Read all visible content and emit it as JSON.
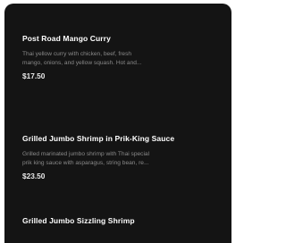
{
  "menu": {
    "items": [
      {
        "title": "Post Road Mango Curry",
        "description_line1": "Thai yellow curry with chicken, beef, fresh",
        "description_line2": "mango, onions, and yellow squash. Hot and...",
        "price": "$17.50"
      },
      {
        "title": "Grilled Jumbo Shrimp in Prik-King Sauce",
        "description_line1": "Grilled marinated jumbo shrimp with Thai special",
        "description_line2": "prik king sauce with asparagus, string bean, re...",
        "price": "$23.50"
      },
      {
        "title": "Grilled Jumbo Sizzling Shrimp"
      }
    ]
  },
  "colors": {
    "panel_background": "#141414",
    "title_text": "#ffffff",
    "description_text": "#8a8a8a",
    "price_text": "#e9e9e9"
  }
}
